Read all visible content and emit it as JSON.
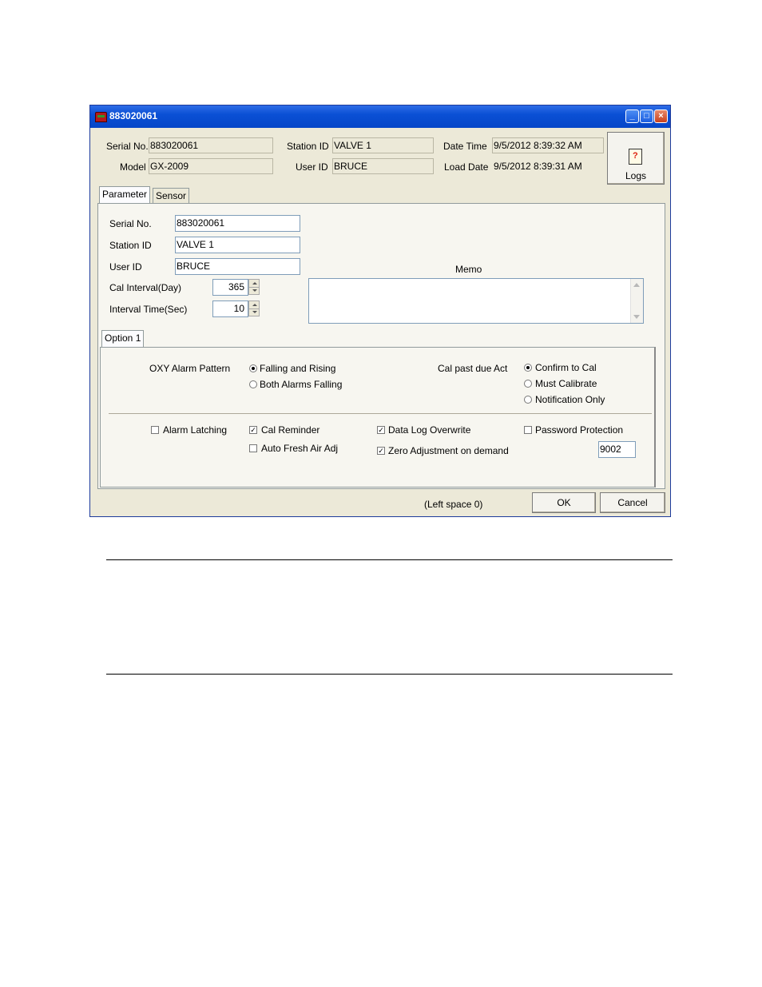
{
  "window": {
    "title": "883020061"
  },
  "header": {
    "serial_label": "Serial No.",
    "serial_value": "883020061",
    "model_label": "Model",
    "model_value": "GX-2009",
    "station_label": "Station ID",
    "station_value": "VALVE 1",
    "user_label": "User ID",
    "user_value": "BRUCE",
    "datetime_label": "Date Time",
    "datetime_value": "9/5/2012 8:39:32 AM",
    "loaddate_label": "Load Date",
    "loaddate_value": "9/5/2012 8:39:31 AM",
    "logs_label": "Logs"
  },
  "tabs": [
    {
      "label": "Parameter"
    },
    {
      "label": "Sensor"
    }
  ],
  "params": {
    "serial_label": "Serial No.",
    "serial_value": "883020061",
    "station_label": "Station ID",
    "station_value": "VALVE 1",
    "user_label": "User ID",
    "user_value": "BRUCE",
    "cal_interval_label": "Cal Interval(Day)",
    "cal_interval_value": "365",
    "interval_time_label": "Interval Time(Sec)",
    "interval_time_value": "10",
    "memo_label": "Memo",
    "memo_value": ""
  },
  "option_tab": {
    "label": "Option 1"
  },
  "oxy": {
    "label": "OXY Alarm Pattern",
    "options": [
      {
        "label": "Falling and Rising",
        "selected": true
      },
      {
        "label": "Both Alarms Falling",
        "selected": false
      }
    ]
  },
  "calpast": {
    "label": "Cal past due Act",
    "options": [
      {
        "label": "Confirm to Cal",
        "selected": true
      },
      {
        "label": "Must Calibrate",
        "selected": false
      },
      {
        "label": "Notification Only",
        "selected": false
      }
    ]
  },
  "checks": {
    "alarm_latching": {
      "label": "Alarm Latching",
      "checked": false
    },
    "cal_reminder": {
      "label": "Cal Reminder",
      "checked": true
    },
    "auto_fresh": {
      "label": "Auto Fresh Air Adj",
      "checked": false
    },
    "data_log": {
      "label": "Data Log Overwrite",
      "checked": true
    },
    "zero_adj": {
      "label": "Zero Adjustment on demand",
      "checked": true
    },
    "password": {
      "label": "Password Protection",
      "checked": false
    }
  },
  "password_value": "9002",
  "footer": {
    "status": "(Left space 0)",
    "ok_label": "OK",
    "cancel_label": "Cancel"
  }
}
